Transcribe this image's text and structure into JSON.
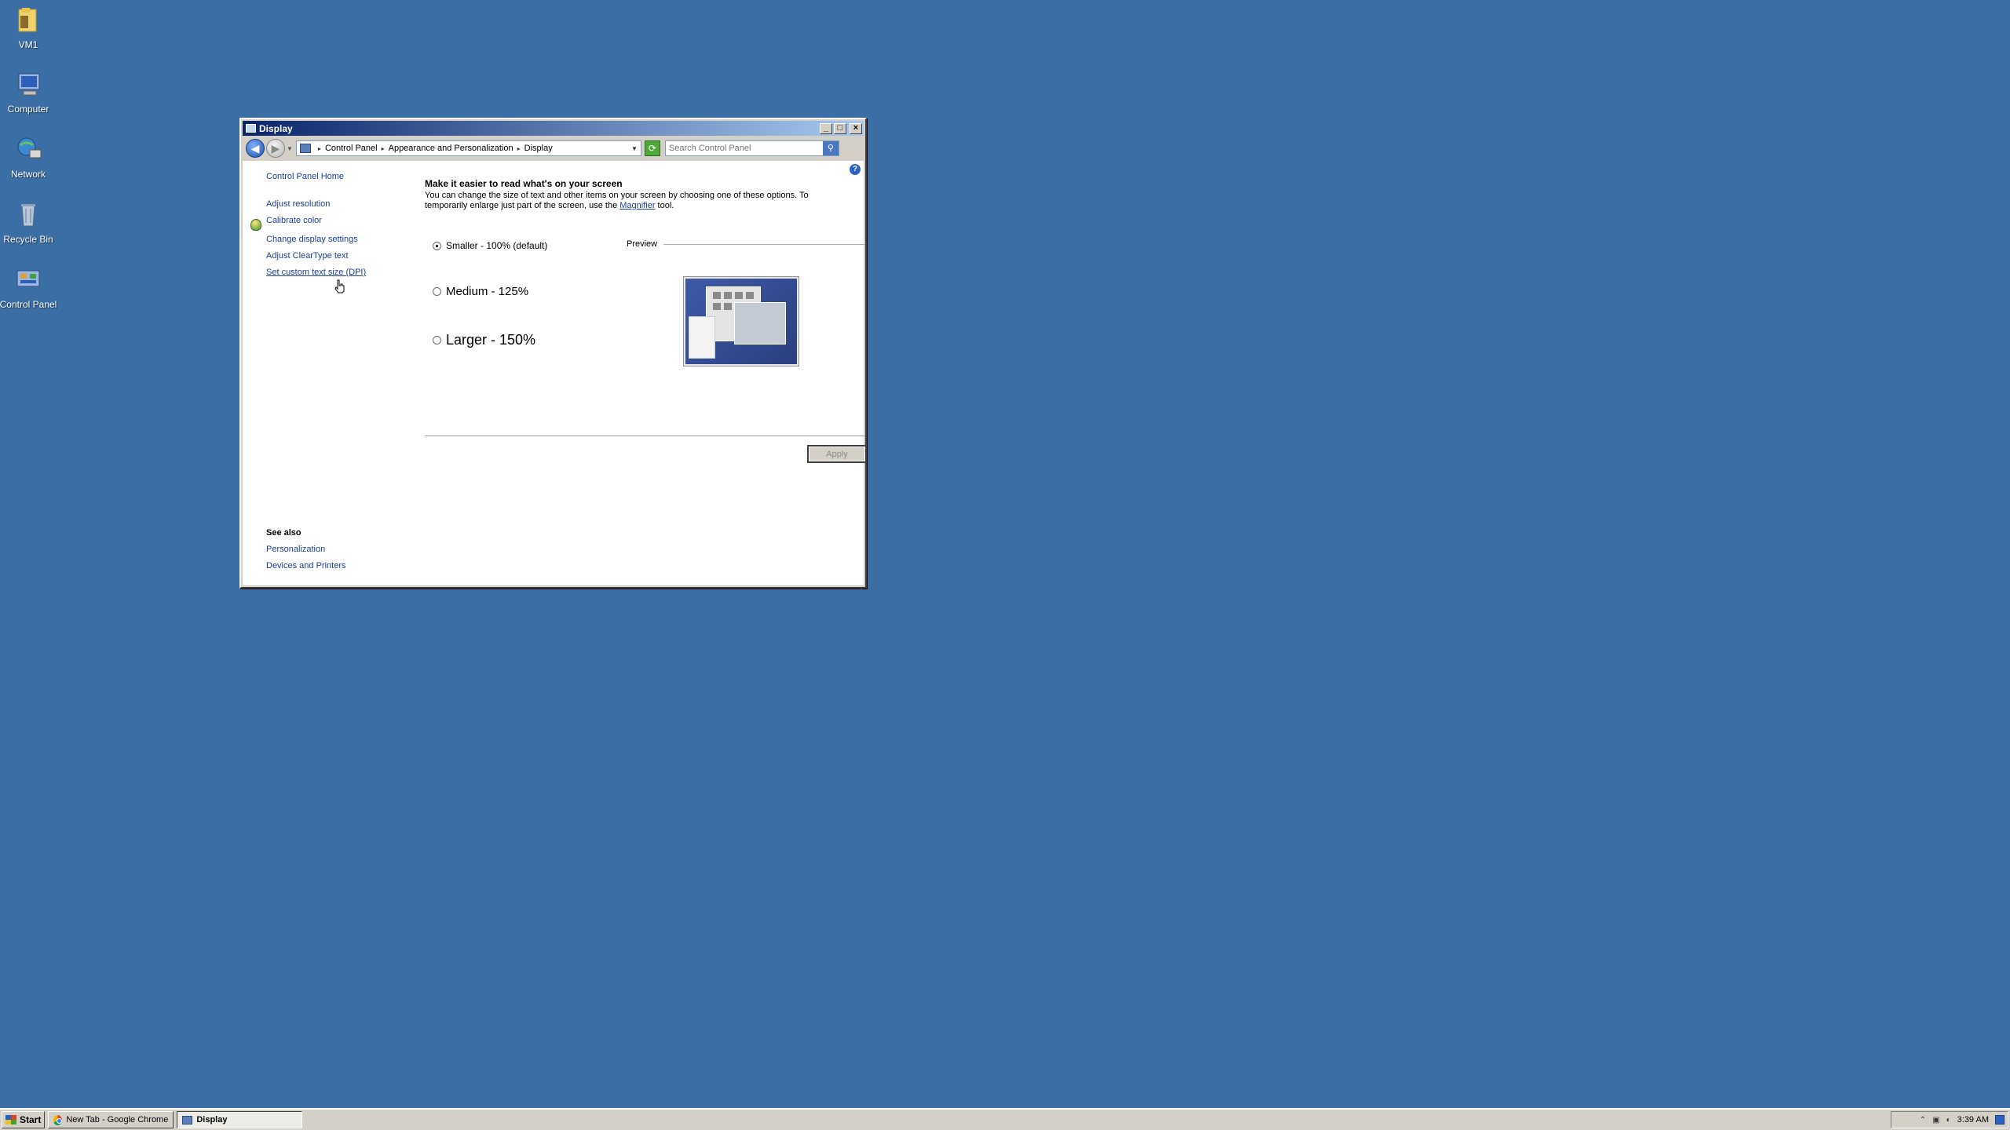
{
  "desktop": {
    "icons": [
      {
        "label": "VM1",
        "icon": "folder-icon"
      },
      {
        "label": "Computer",
        "icon": "computer-icon"
      },
      {
        "label": "Network",
        "icon": "network-icon"
      },
      {
        "label": "Recycle Bin",
        "icon": "recycle-bin-icon"
      },
      {
        "label": "Control Panel",
        "icon": "control-panel-icon"
      }
    ]
  },
  "window": {
    "title": "Display",
    "address": {
      "crumbs": [
        "Control Panel",
        "Appearance and Personalization",
        "Display"
      ],
      "search_placeholder": "Search Control Panel"
    },
    "help": "?",
    "leftnav": {
      "home": "Control Panel Home",
      "links": [
        "Adjust resolution",
        "Calibrate color",
        "Change display settings",
        "Adjust ClearType text",
        "Set custom text size (DPI)"
      ],
      "see_also_title": "See also",
      "see_also": [
        "Personalization",
        "Devices and Printers"
      ]
    },
    "main": {
      "title": "Make it easier to read what's on your screen",
      "desc_before": "You can change the size of text and other items on your screen by choosing one of these options. To temporarily enlarge just part of the screen, use the ",
      "desc_link": "Magnifier",
      "desc_after": " tool.",
      "options": [
        {
          "label": "Smaller - 100% (default)",
          "checked": true
        },
        {
          "label": "Medium - 125%",
          "checked": false
        },
        {
          "label": "Larger - 150%",
          "checked": false
        }
      ],
      "preview_label": "Preview",
      "apply": "Apply"
    }
  },
  "taskbar": {
    "start": "Start",
    "tasks": [
      {
        "label": "New Tab - Google Chrome",
        "active": false
      },
      {
        "label": "Display",
        "active": true
      }
    ],
    "clock": "3:39 AM"
  }
}
